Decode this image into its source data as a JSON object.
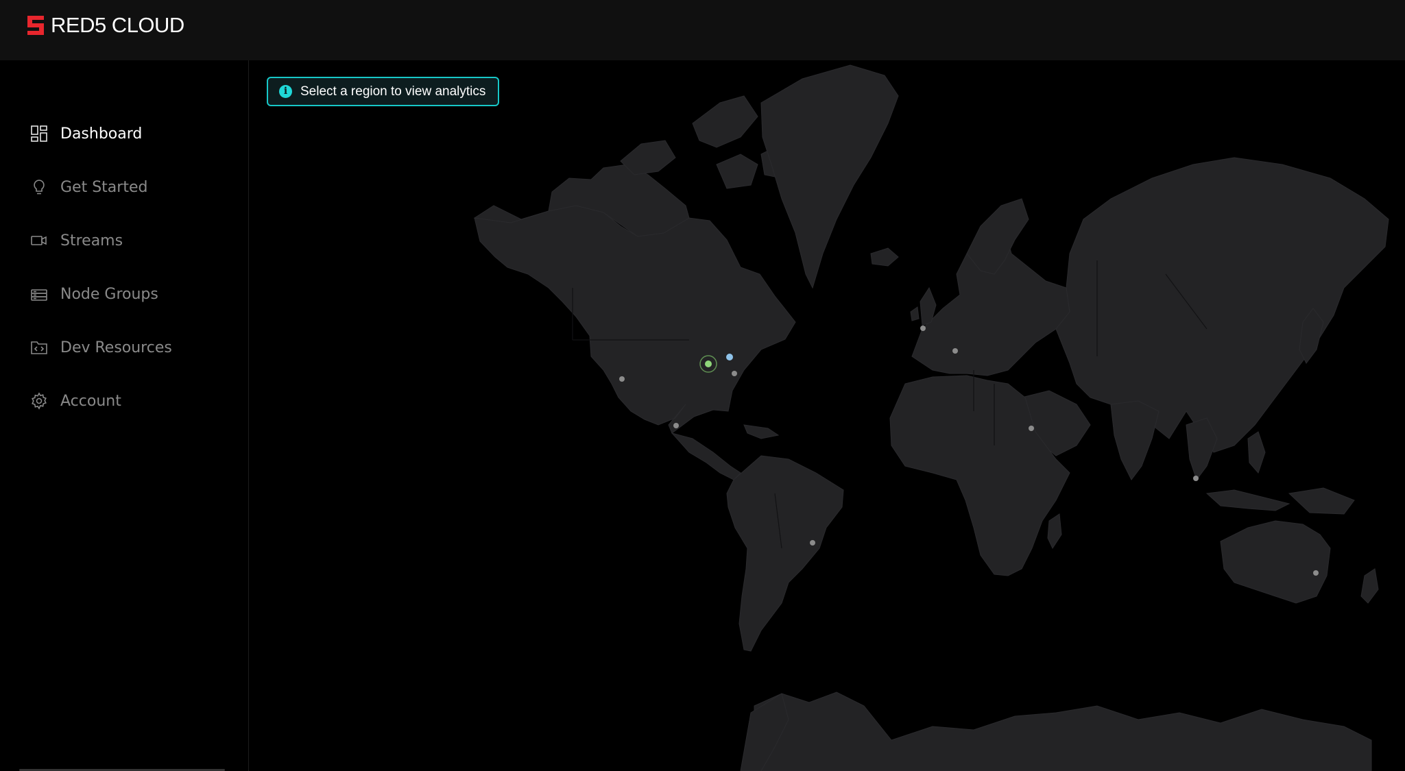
{
  "app": {
    "logo_text": "RED5 CLOUD",
    "brand_color": "#e8262d"
  },
  "sidebar": {
    "items": [
      {
        "label": "Dashboard",
        "icon": "dashboard-icon",
        "active": true
      },
      {
        "label": "Get Started",
        "icon": "lightbulb-icon",
        "active": false
      },
      {
        "label": "Streams",
        "icon": "video-camera-icon",
        "active": false
      },
      {
        "label": "Node Groups",
        "icon": "server-stack-icon",
        "active": false
      },
      {
        "label": "Dev Resources",
        "icon": "code-folder-icon",
        "active": false
      },
      {
        "label": "Account",
        "icon": "gear-icon",
        "active": false
      }
    ]
  },
  "map": {
    "callout_text": "Select a region to view analytics",
    "callout_icon": "info-icon",
    "accent_color": "#17c8c8",
    "active_region_color": "#8fd67a",
    "secondary_region_color": "#8fc3ea",
    "region_color": "#8c8c8c"
  }
}
